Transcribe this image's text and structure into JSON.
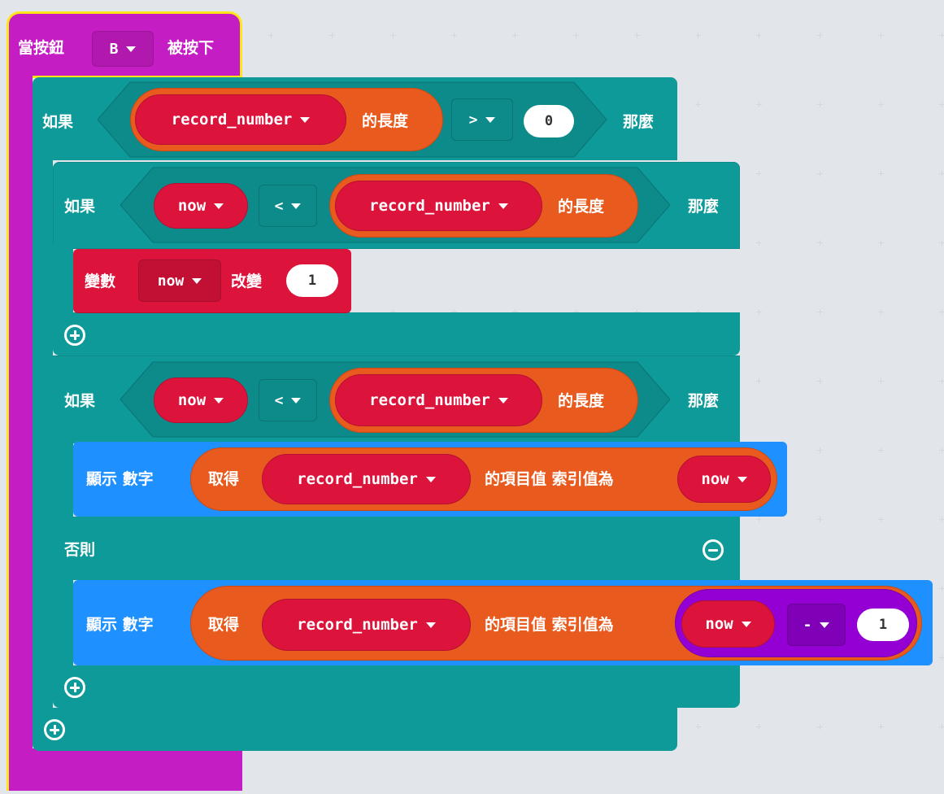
{
  "colors": {
    "event": "#c51dc4",
    "logic": "#0f9a9a",
    "variable": "#dc143c",
    "list": "#e85a1e",
    "basic": "#1e90ff",
    "math": "#9400d3",
    "highlight": "#ffe61a"
  },
  "event_block": {
    "label_prefix": "當按鈕",
    "button_value": "B",
    "label_suffix": "被按下"
  },
  "outer_if": {
    "if_label": "如果",
    "then_label": "那麼",
    "list_var": "record_number",
    "length_label": "的長度",
    "operator": ">",
    "value": "0"
  },
  "inner_if1": {
    "if_label": "如果",
    "then_label": "那麼",
    "var": "now",
    "operator": "<",
    "list_var": "record_number",
    "length_label": "的長度"
  },
  "change_block": {
    "label": "變數",
    "var": "now",
    "change_label": "改變",
    "value": "1"
  },
  "inner_if2": {
    "if_label": "如果",
    "then_label": "那麼",
    "else_label": "否則",
    "var": "now",
    "operator": "<",
    "list_var": "record_number",
    "length_label": "的長度"
  },
  "show1": {
    "label": "顯示 數字",
    "get_label": "取得",
    "list_var": "record_number",
    "item_label": "的項目值 索引值為",
    "index_var": "now"
  },
  "show2": {
    "label": "顯示 數字",
    "get_label": "取得",
    "list_var": "record_number",
    "item_label": "的項目值 索引值為",
    "index_var": "now",
    "operator": "-",
    "value": "1"
  }
}
